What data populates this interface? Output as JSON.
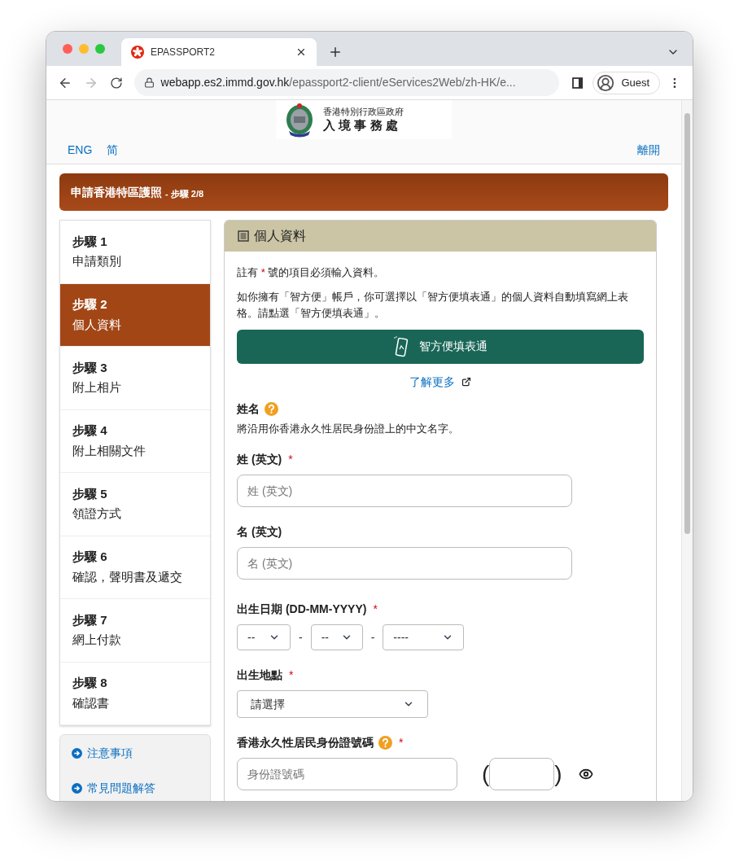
{
  "browser": {
    "tab_title": "EPASSPORT2",
    "url_host": "webapp.es2.immd.gov.hk",
    "url_path": "/epassport2-client/eServices2Web/zh-HK/e...",
    "profile": "Guest"
  },
  "header": {
    "logo_lines": [
      "香港特別行政區政府",
      "入 境 事 務 處"
    ],
    "languages": [
      "ENG",
      "简"
    ],
    "logout": "離開"
  },
  "banner": {
    "title": "申請香港特區護照",
    "step": "- 步驟 2/8"
  },
  "steps": [
    {
      "number": "步驟 1",
      "name": "申請類別",
      "selected": false
    },
    {
      "number": "步驟 2",
      "name": "個人資料",
      "selected": true
    },
    {
      "number": "步驟 3",
      "name": "附上相片",
      "selected": false
    },
    {
      "number": "步驟 4",
      "name": "附上相關文件",
      "selected": false
    },
    {
      "number": "步驟 5",
      "name": "領證方式",
      "selected": false
    },
    {
      "number": "步驟 6",
      "name": "確認，聲明書及遞交",
      "selected": false
    },
    {
      "number": "步驟 7",
      "name": "網上付款",
      "selected": false
    },
    {
      "number": "步驟 8",
      "name": "確認書",
      "selected": false
    }
  ],
  "links": [
    "注意事項",
    "常見問題解答"
  ],
  "section": {
    "title": "個人資料",
    "required_mark": "*",
    "note_before": "註有",
    "note_after": "號的項目必須輸入資料。",
    "intro": "如你擁有「智方便」帳戶，你可選擇以「智方便填表通」的個人資料自動填寫網上表格。請點選「智方便填表通」。",
    "iam_button": "智方便填表通",
    "learn_more": "了解更多",
    "name_title": "姓名",
    "name_help": true,
    "name_hint": "將沿用你香港永久性居民身份證上的中文名字。",
    "fields": [
      {
        "kind": "text",
        "label": "姓 (英文)",
        "required": true,
        "help": false,
        "placeholder": "姓 (英文)"
      },
      {
        "kind": "text",
        "label": "名 (英文)",
        "required": false,
        "help": false,
        "placeholder": "名 (英文)"
      },
      {
        "kind": "date",
        "label": "出生日期 (DD-MM-YYYY)",
        "required": true,
        "help": false,
        "parts": [
          "--",
          "--",
          "----"
        ],
        "separators": [
          "-",
          "-"
        ]
      },
      {
        "kind": "select",
        "label": "出生地點",
        "required": true,
        "help": false,
        "value": "請選擇"
      },
      {
        "kind": "id",
        "label": "香港永久性居民身份證號碼",
        "required": true,
        "help": true,
        "placeholder": "身份證號碼",
        "open": "(",
        "close": ")"
      }
    ]
  }
}
